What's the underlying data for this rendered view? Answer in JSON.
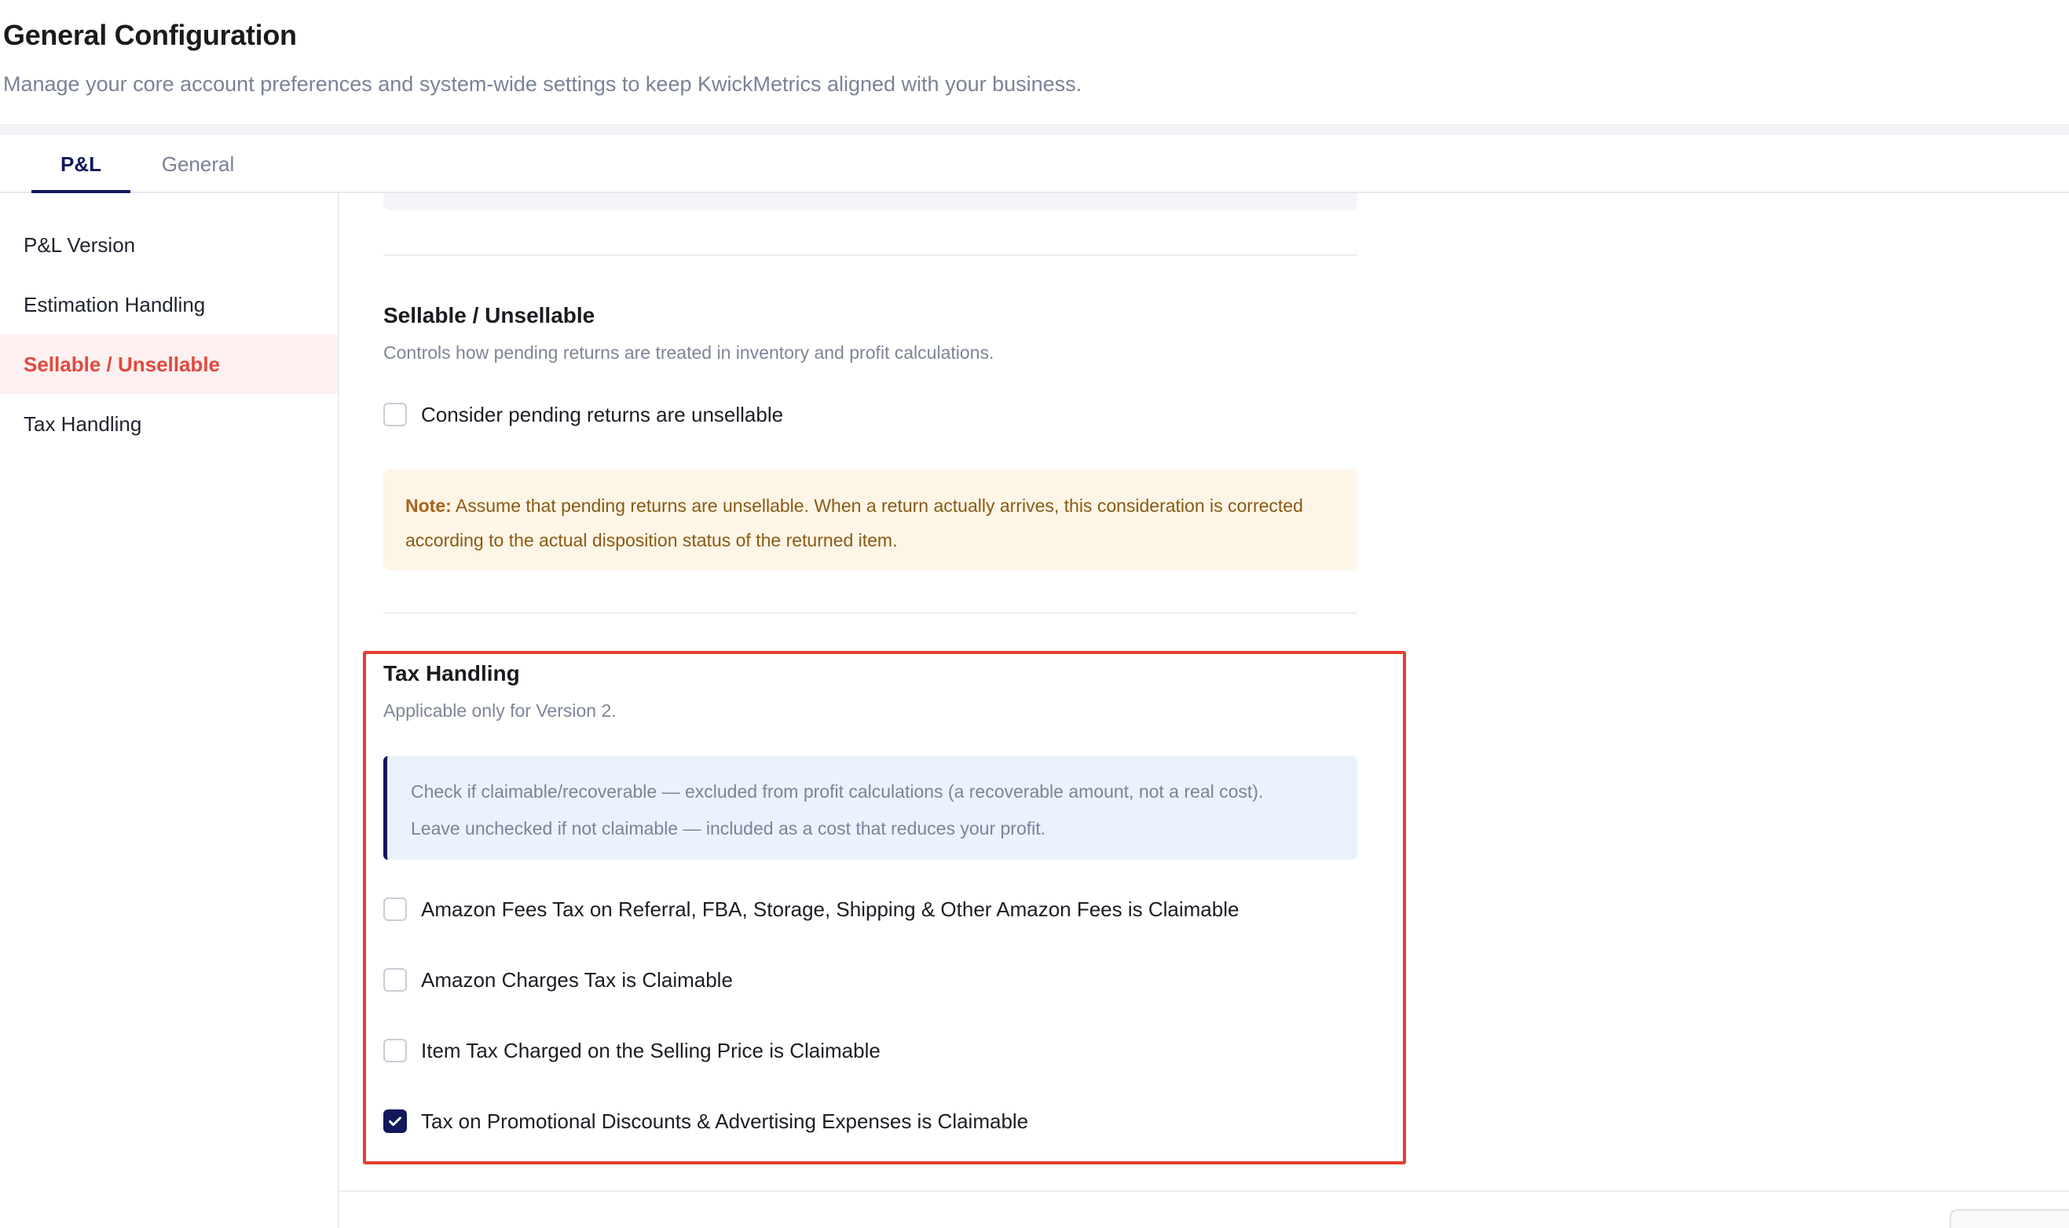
{
  "header": {
    "title": "General Configuration",
    "subtitle": "Manage your core account preferences and system-wide settings to keep KwickMetrics aligned with your business."
  },
  "tabs": [
    {
      "label": "P&L",
      "active": true
    },
    {
      "label": "General",
      "active": false
    }
  ],
  "sidebar": {
    "items": [
      {
        "label": "P&L Version",
        "active": false
      },
      {
        "label": "Estimation Handling",
        "active": false
      },
      {
        "label": "Sellable / Unsellable",
        "active": true
      },
      {
        "label": "Tax Handling",
        "active": false
      }
    ]
  },
  "sellable": {
    "title": "Sellable / Unsellable",
    "description": "Controls how pending returns are treated in inventory and profit calculations.",
    "checkbox_label": "Consider pending returns are unsellable",
    "checked": false,
    "note_label": "Note:",
    "note_text": " Assume that pending returns are unsellable. When a return actually arrives, this consideration is corrected according to the actual disposition status of the returned item."
  },
  "tax": {
    "title": "Tax Handling",
    "description": "Applicable only for Version 2.",
    "info_line1": "Check if claimable/recoverable — excluded from profit calculations (a recoverable amount, not a real cost).",
    "info_line2": "Leave unchecked if not claimable — included as a cost that reduces your profit.",
    "options": [
      {
        "label": "Amazon Fees Tax on Referral, FBA, Storage, Shipping & Other Amazon Fees is Claimable",
        "checked": false
      },
      {
        "label": "Amazon Charges Tax is Claimable",
        "checked": false
      },
      {
        "label": "Item Tax Charged on the Selling Price is Claimable",
        "checked": false
      },
      {
        "label": "Tax on Promotional Discounts & Advertising Expenses is Claimable",
        "checked": true
      }
    ]
  },
  "colors": {
    "accent": "#12185a",
    "active_sidebar": "#e04a3f",
    "highlight_border": "#e3412d"
  }
}
